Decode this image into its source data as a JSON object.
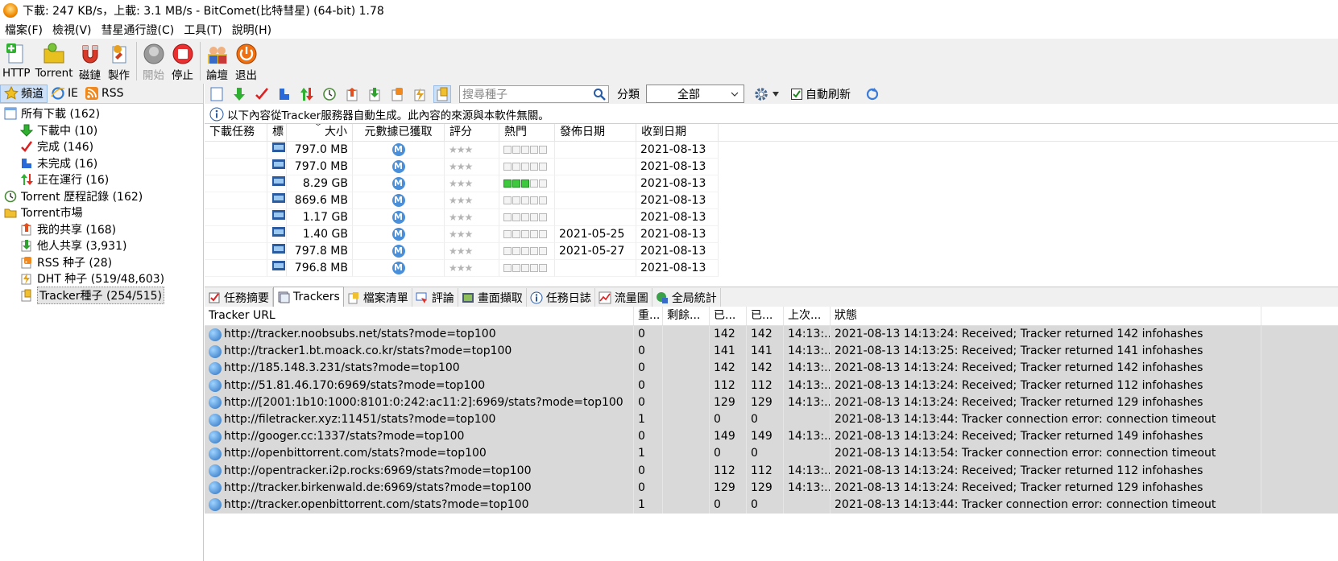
{
  "window": {
    "title": "下載: 247 KB/s，上載: 3.1 MB/s - BitComet(比特彗星) (64-bit) 1.78"
  },
  "menu": [
    "檔案(F)",
    "檢視(V)",
    "彗星通行證(C)",
    "工具(T)",
    "說明(H)"
  ],
  "toolbar": [
    {
      "name": "http",
      "label": "HTTP",
      "icon": "http-add-icon"
    },
    {
      "name": "torrent",
      "label": "Torrent",
      "icon": "torrent-icon"
    },
    {
      "name": "magnet",
      "label": "磁鏈",
      "icon": "magnet-icon"
    },
    {
      "name": "make",
      "label": "製作",
      "icon": "make-torrent-icon"
    },
    {
      "name": "start",
      "label": "開始",
      "icon": "start-icon",
      "disabled": true
    },
    {
      "name": "stop",
      "label": "停止",
      "icon": "stop-icon"
    },
    {
      "name": "forum",
      "label": "論壇",
      "icon": "forum-icon"
    },
    {
      "name": "exit",
      "label": "退出",
      "icon": "exit-icon"
    }
  ],
  "left_tabs": [
    "頻道",
    "IE",
    "RSS"
  ],
  "tree": [
    {
      "label": "所有下載 (162)",
      "indent": 0,
      "icon": "all-downloads-icon"
    },
    {
      "label": "下載中 (10)",
      "indent": 1,
      "icon": "downloading-arrow-icon"
    },
    {
      "label": "完成 (146)",
      "indent": 1,
      "icon": "checkmark-icon"
    },
    {
      "label": "未完成 (16)",
      "indent": 1,
      "icon": "incomplete-icon"
    },
    {
      "label": "正在運行 (16)",
      "indent": 1,
      "icon": "running-arrows-icon"
    },
    {
      "label": "Torrent 歷程記錄 (162)",
      "indent": 0,
      "icon": "history-icon"
    },
    {
      "label": "Torrent市場",
      "indent": 0,
      "icon": "folder-icon"
    },
    {
      "label": "我的共享 (168)",
      "indent": 1,
      "icon": "my-share-icon"
    },
    {
      "label": "他人共享 (3,931)",
      "indent": 1,
      "icon": "others-share-icon"
    },
    {
      "label": "RSS 种子 (28)",
      "indent": 1,
      "icon": "rss-icon"
    },
    {
      "label": "DHT 种子 (519/48,603)",
      "indent": 1,
      "icon": "dht-icon"
    },
    {
      "label": "Tracker種子 (254/515)",
      "indent": 1,
      "icon": "tracker-seed-icon",
      "selected": true
    }
  ],
  "search": {
    "placeholder": "搜尋種子"
  },
  "category": {
    "label": "分類",
    "value": "全部"
  },
  "auto_refresh": {
    "label": "自動刷新",
    "checked": true
  },
  "info": "以下內容從Tracker服務器自動生成。此內容的來源與本軟件無關。",
  "torrent_columns": [
    "下載任務",
    "標",
    "大小",
    "元數據已獲取",
    "評分",
    "熱門",
    "發佈日期",
    "收到日期"
  ],
  "torrent_rows": [
    {
      "size": "797.0 MB",
      "heat": 0,
      "pub": "",
      "recv": "2021-08-13"
    },
    {
      "size": "797.0 MB",
      "heat": 0,
      "pub": "",
      "recv": "2021-08-13"
    },
    {
      "size": "8.29 GB",
      "heat": 3,
      "pub": "",
      "recv": "2021-08-13"
    },
    {
      "size": "869.6 MB",
      "heat": 0,
      "pub": "",
      "recv": "2021-08-13"
    },
    {
      "size": "1.17 GB",
      "heat": 0,
      "pub": "",
      "recv": "2021-08-13"
    },
    {
      "size": "1.40 GB",
      "heat": 0,
      "pub": "2021-05-25",
      "recv": "2021-08-13"
    },
    {
      "size": "797.8 MB",
      "heat": 0,
      "pub": "2021-05-27",
      "recv": "2021-08-13"
    },
    {
      "size": "796.8 MB",
      "heat": 0,
      "pub": "",
      "recv": "2021-08-13"
    }
  ],
  "meta_badge": "M",
  "bottom_tabs": [
    "任務摘要",
    "Trackers",
    "檔案清單",
    "評論",
    "畫面擷取",
    "任務日誌",
    "流量圖",
    "全局統計"
  ],
  "tracker_columns": [
    "Tracker URL",
    "重...",
    "剩餘...",
    "已...",
    "已...",
    "上次...",
    "狀態"
  ],
  "trackers": [
    {
      "url": "http://tracker.noobsubs.net/stats?mode=top100",
      "c1": "0",
      "c2": "",
      "c3": "142",
      "c4": "142",
      "c5": "14:13:...",
      "status": "2021-08-13 14:13:24: Received; Tracker returned 142 infohashes"
    },
    {
      "url": "http://tracker1.bt.moack.co.kr/stats?mode=top100",
      "c1": "0",
      "c2": "",
      "c3": "141",
      "c4": "141",
      "c5": "14:13:...",
      "status": "2021-08-13 14:13:25: Received; Tracker returned 141 infohashes"
    },
    {
      "url": "http://185.148.3.231/stats?mode=top100",
      "c1": "0",
      "c2": "",
      "c3": "142",
      "c4": "142",
      "c5": "14:13:...",
      "status": "2021-08-13 14:13:24: Received; Tracker returned 142 infohashes"
    },
    {
      "url": "http://51.81.46.170:6969/stats?mode=top100",
      "c1": "0",
      "c2": "",
      "c3": "112",
      "c4": "112",
      "c5": "14:13:...",
      "status": "2021-08-13 14:13:24: Received; Tracker returned 112 infohashes"
    },
    {
      "url": "http://[2001:1b10:1000:8101:0:242:ac11:2]:6969/stats?mode=top100",
      "c1": "0",
      "c2": "",
      "c3": "129",
      "c4": "129",
      "c5": "14:13:...",
      "status": "2021-08-13 14:13:24: Received; Tracker returned 129 infohashes"
    },
    {
      "url": "http://filetracker.xyz:11451/stats?mode=top100",
      "c1": "1",
      "c2": "",
      "c3": "0",
      "c4": "0",
      "c5": "",
      "status": "2021-08-13 14:13:44: Tracker connection error: connection timeout"
    },
    {
      "url": "http://googer.cc:1337/stats?mode=top100",
      "c1": "0",
      "c2": "",
      "c3": "149",
      "c4": "149",
      "c5": "14:13:...",
      "status": "2021-08-13 14:13:24: Received; Tracker returned 149 infohashes"
    },
    {
      "url": "http://openbittorrent.com/stats?mode=top100",
      "c1": "1",
      "c2": "",
      "c3": "0",
      "c4": "0",
      "c5": "",
      "status": "2021-08-13 14:13:54: Tracker connection error: connection timeout"
    },
    {
      "url": "http://opentracker.i2p.rocks:6969/stats?mode=top100",
      "c1": "0",
      "c2": "",
      "c3": "112",
      "c4": "112",
      "c5": "14:13:...",
      "status": "2021-08-13 14:13:24: Received; Tracker returned 112 infohashes"
    },
    {
      "url": "http://tracker.birkenwald.de:6969/stats?mode=top100",
      "c1": "0",
      "c2": "",
      "c3": "129",
      "c4": "129",
      "c5": "14:13:...",
      "status": "2021-08-13 14:13:24: Received; Tracker returned 129 infohashes"
    },
    {
      "url": "http://tracker.openbittorrent.com/stats?mode=top100",
      "c1": "1",
      "c2": "",
      "c3": "0",
      "c4": "0",
      "c5": "",
      "status": "2021-08-13 14:13:44: Tracker connection error: connection timeout"
    }
  ]
}
